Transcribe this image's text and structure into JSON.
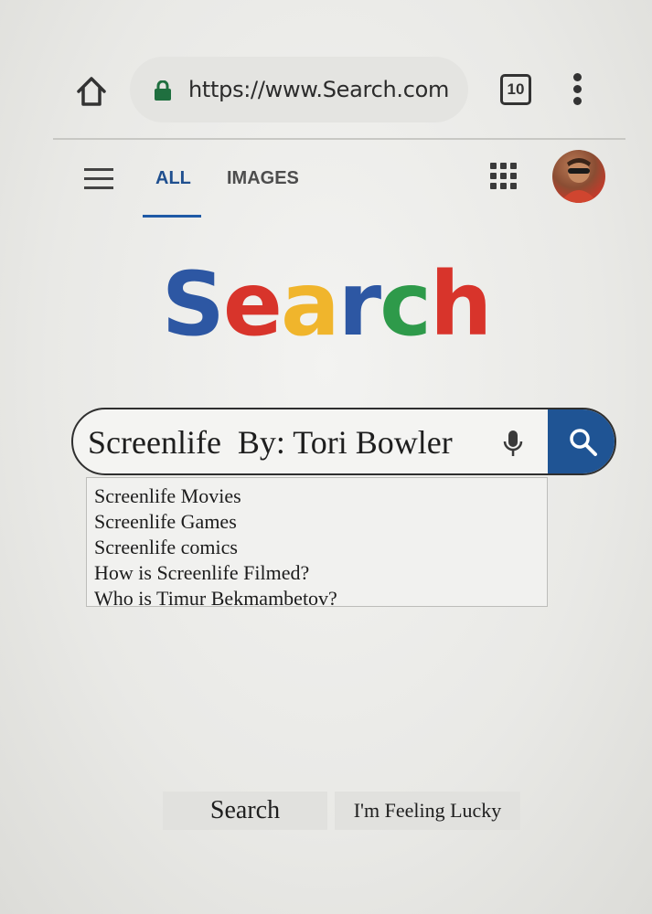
{
  "browser": {
    "url": "https://www.Search.com",
    "tab_count": "10",
    "icons": {
      "home": "home-icon",
      "lock": "lock-icon",
      "tabs": "tabs-icon",
      "menu": "more-vert-icon"
    }
  },
  "nav": {
    "tabs": [
      {
        "label": "ALL",
        "active": true
      },
      {
        "label": "IMAGES",
        "active": false
      }
    ],
    "icons": {
      "menu": "hamburger-icon",
      "apps": "apps-grid-icon",
      "avatar": "avatar"
    }
  },
  "logo": {
    "letters": [
      {
        "char": "S",
        "color": "#2d57a3"
      },
      {
        "char": "e",
        "color": "#d8342b"
      },
      {
        "char": "a",
        "color": "#f0b52c"
      },
      {
        "char": "r",
        "color": "#2d57a3"
      },
      {
        "char": "c",
        "color": "#2e9a4a"
      },
      {
        "char": "h",
        "color": "#d8342b"
      }
    ]
  },
  "search": {
    "value": "Screenlife  By: Tori Bowler",
    "icons": {
      "mic": "mic-icon",
      "submit": "search-icon"
    },
    "accent": "#1f5494"
  },
  "suggestions": [
    "Screenlife Movies",
    "Screenlife Games",
    "Screenlife comics",
    "How is Screenlife Filmed?",
    "Who is Timur Bekmambetov?"
  ],
  "buttons": {
    "search_label": "Search",
    "lucky_label": "I'm Feeling Lucky"
  }
}
